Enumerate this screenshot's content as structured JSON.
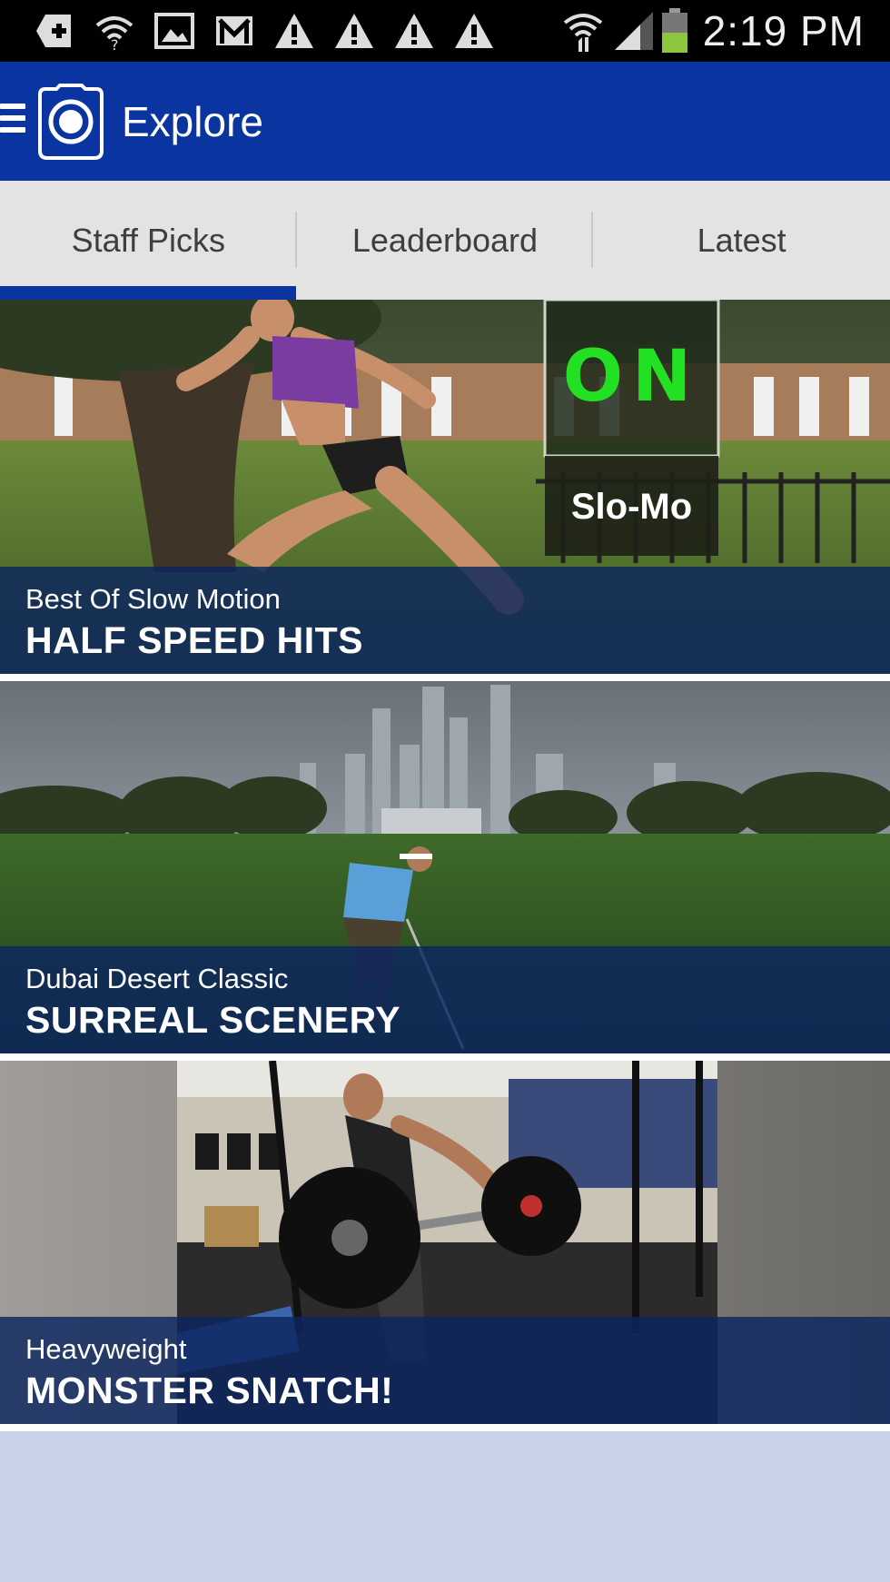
{
  "status_bar": {
    "time": "2:19 PM",
    "left_icons": [
      "plus-icon",
      "wifi-question-icon",
      "image-icon",
      "gmail-icon",
      "warning-icon",
      "warning-icon",
      "warning-icon",
      "warning-icon"
    ],
    "right_icons": [
      "wifi-icon",
      "signal-icon",
      "battery-icon"
    ]
  },
  "app_bar": {
    "title": "Explore",
    "color": "#0a35a0"
  },
  "tabs": [
    {
      "label": "Staff Picks",
      "selected": true
    },
    {
      "label": "Leaderboard",
      "selected": false
    },
    {
      "label": "Latest",
      "selected": false
    }
  ],
  "feed": [
    {
      "subtitle": "Best Of Slow Motion",
      "title": "HALF SPEED HITS",
      "overlay": {
        "on_text": "ON",
        "slomo_text": "Slo-Mo"
      }
    },
    {
      "subtitle": "Dubai Desert Classic",
      "title": "SURREAL SCENERY"
    },
    {
      "subtitle": "Heavyweight",
      "title": "MONSTER SNATCH!"
    }
  ]
}
